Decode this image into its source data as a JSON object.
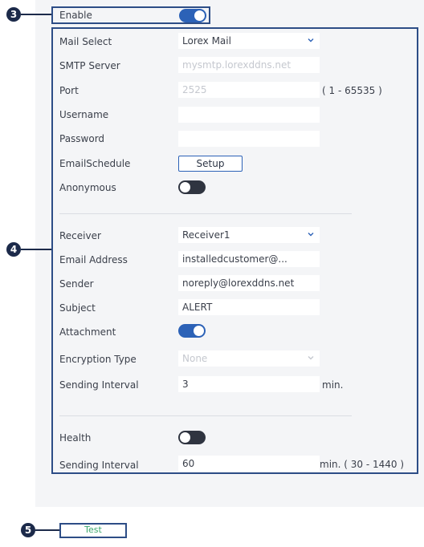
{
  "callouts": [
    "3",
    "4",
    "5"
  ],
  "enable": {
    "label": "Enable",
    "state": "on"
  },
  "mail_select": {
    "label": "Mail Select",
    "value": "Lorex Mail"
  },
  "smtp_server": {
    "label": "SMTP Server",
    "value": "mysmtp.lorexddns.net"
  },
  "port": {
    "label": "Port",
    "value": "2525",
    "range": "( 1 - 65535 )"
  },
  "username": {
    "label": "Username",
    "value": ""
  },
  "password": {
    "label": "Password",
    "value": ""
  },
  "email_schedule": {
    "label": "EmailSchedule",
    "button": "Setup"
  },
  "anonymous": {
    "label": "Anonymous",
    "state": "off"
  },
  "receiver": {
    "label": "Receiver",
    "value": "Receiver1"
  },
  "email_address": {
    "label": "Email Address",
    "value": "installedcustomer@..."
  },
  "sender": {
    "label": "Sender",
    "value": "noreply@lorexddns.net"
  },
  "subject": {
    "label": "Subject",
    "value": "ALERT"
  },
  "attachment": {
    "label": "Attachment",
    "state": "on"
  },
  "encryption_type": {
    "label": "Encryption Type",
    "value": "None"
  },
  "sending_interval": {
    "label": "Sending Interval",
    "value": "3",
    "unit": "min."
  },
  "health": {
    "label": "Health",
    "state": "off"
  },
  "health_interval": {
    "label": "Sending Interval",
    "value": "60",
    "unit": "min. ( 30 - 1440 )"
  },
  "test_button": {
    "label": "Test"
  },
  "colors": {
    "accent": "#2c62b7",
    "callout": "#1c2a4a",
    "test_text": "#3aa76d"
  }
}
